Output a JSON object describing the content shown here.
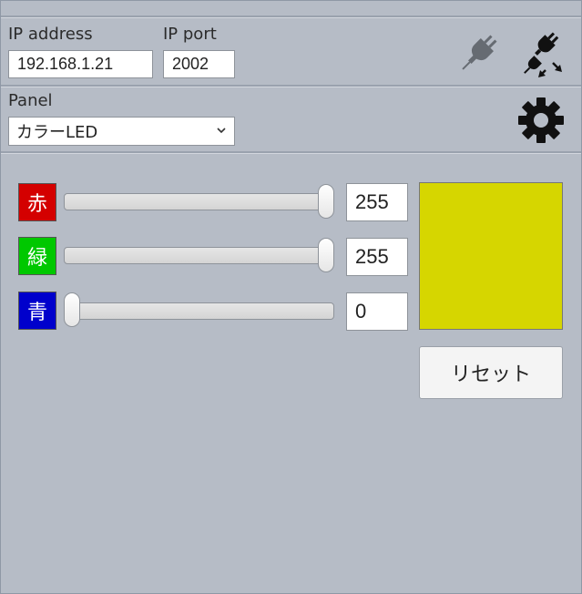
{
  "connection": {
    "ip_address_label": "IP address",
    "ip_address_value": "192.168.1.21",
    "ip_port_label": "IP port",
    "ip_port_value": "2002",
    "connect_icon": "plug-connected-icon",
    "disconnect_icon": "plug-disconnected-icon"
  },
  "panel": {
    "label": "Panel",
    "selected": "カラーLED",
    "settings_icon": "gear-icon"
  },
  "sliders": [
    {
      "label": "赤",
      "color": "#d40000",
      "value": "255",
      "fraction": 1.0
    },
    {
      "label": "緑",
      "color": "#00c800",
      "value": "255",
      "fraction": 1.0
    },
    {
      "label": "青",
      "color": "#0000cc",
      "value": "0",
      "fraction": 0.0
    }
  ],
  "preview": {
    "color": "#d6d600"
  },
  "reset_button": {
    "label": "リセット"
  }
}
